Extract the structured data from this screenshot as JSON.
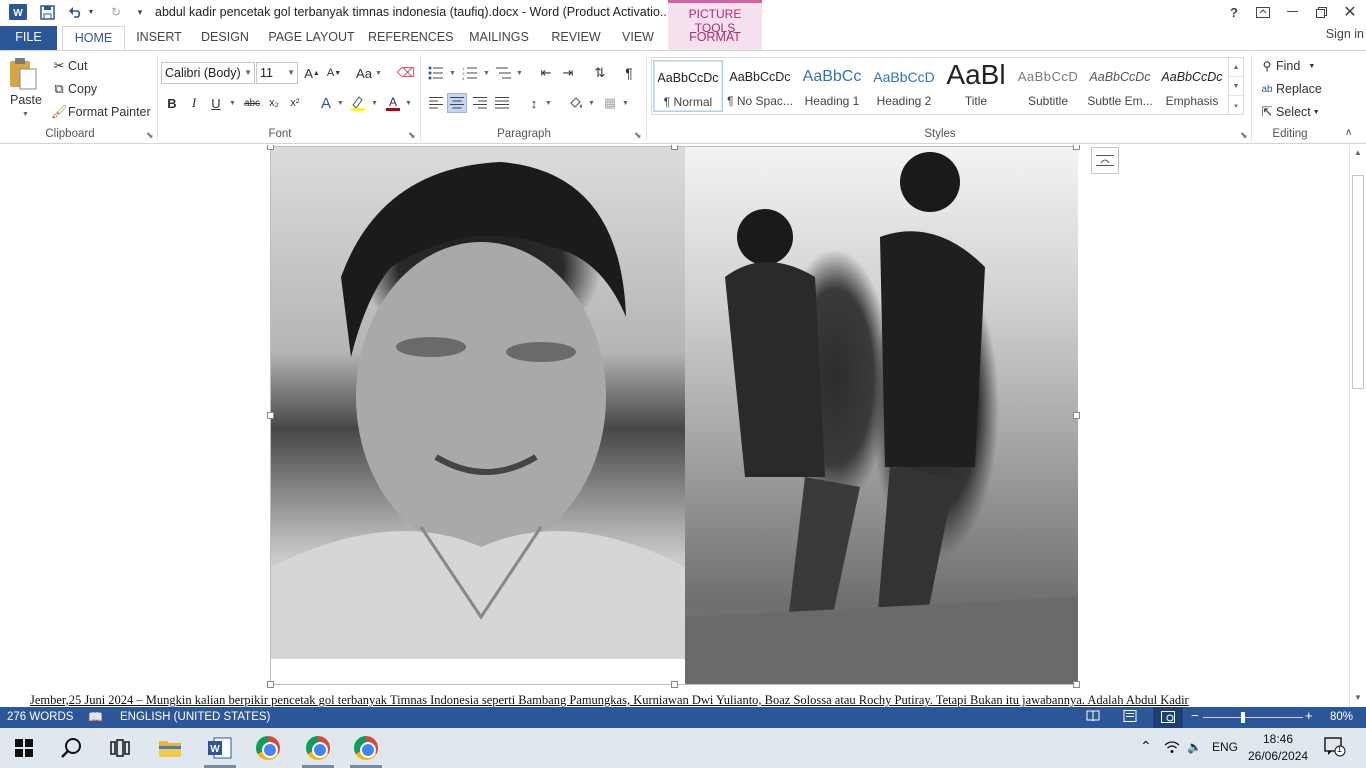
{
  "titlebar": {
    "document_title": "abdul kadir pencetak gol terbanyak timnas indonesia (taufiq).docx - Word (Product Activatio...",
    "picture_tools": "PICTURE TOOLS",
    "help": "?"
  },
  "tabs": {
    "file": "FILE",
    "home": "HOME",
    "insert": "INSERT",
    "design": "DESIGN",
    "page_layout": "PAGE LAYOUT",
    "references": "REFERENCES",
    "mailings": "MAILINGS",
    "review": "REVIEW",
    "view": "VIEW",
    "format": "FORMAT",
    "sign_in": "Sign in"
  },
  "clipboard": {
    "paste": "Paste",
    "cut": "Cut",
    "copy": "Copy",
    "format_painter": "Format Painter",
    "label": "Clipboard"
  },
  "font": {
    "name": "Calibri (Body)",
    "size": "11",
    "case_label": "Aa",
    "bold": "B",
    "italic": "I",
    "underline": "U",
    "strikethrough": "abc",
    "subscript": "x₂",
    "superscript": "x²",
    "label": "Font"
  },
  "paragraph": {
    "label": "Paragraph",
    "show_marks": "¶"
  },
  "styles": {
    "label": "Styles",
    "items": [
      {
        "preview": "AaBbCcDc",
        "name": "¶ Normal"
      },
      {
        "preview": "AaBbCcDc",
        "name": "¶ No Spac..."
      },
      {
        "preview": "AaBbCc",
        "name": "Heading 1"
      },
      {
        "preview": "AaBbCcD",
        "name": "Heading 2"
      },
      {
        "preview": "AaBl",
        "name": "Title"
      },
      {
        "preview": "AaBbCcD",
        "name": "Subtitle"
      },
      {
        "preview": "AaBbCcDc",
        "name": "Subtle Em..."
      },
      {
        "preview": "AaBbCcDc",
        "name": "Emphasis"
      }
    ]
  },
  "editing": {
    "find": "Find",
    "replace": "Replace",
    "select": "Select",
    "label": "Editing"
  },
  "document": {
    "body_text": "Jember,25 Juni 2024 – Mungkin kalian berpikir pencetak gol terbanyak Timnas Indonesia seperti Bambang Pamungkas, Kurniawan Dwi Yulianto, Boaz Solossa atau Rochy Putiray. Tetapi Bukan itu jawabannya. Adalah Abdul Kadir"
  },
  "statusbar": {
    "words": "276 WORDS",
    "language": "ENGLISH (UNITED STATES)",
    "zoom": "80%",
    "zoom_level": 0.4
  },
  "taskbar": {
    "language": "ENG",
    "time": "18:46",
    "date": "26/06/2024",
    "notifications": "1"
  }
}
